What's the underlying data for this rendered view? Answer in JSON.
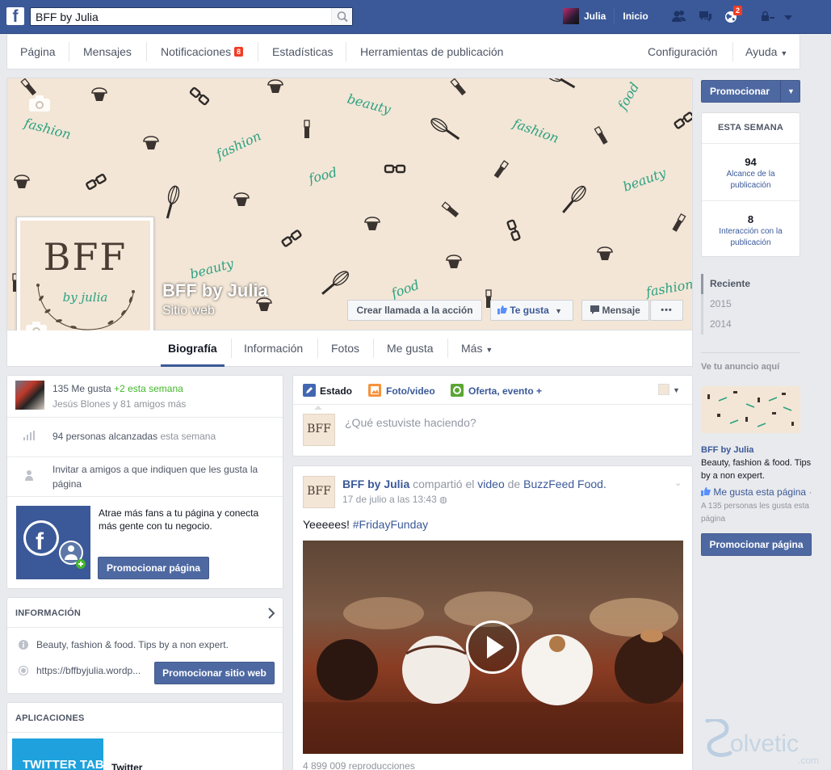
{
  "topbar": {
    "search_value": "BFF by Julia",
    "user_name": "Julia",
    "home_label": "Inicio",
    "notifications_badge": "2",
    "brand_color": "#3b5998"
  },
  "page_nav": {
    "items": [
      "Página",
      "Mensajes",
      "Notificaciones",
      "Estadísticas",
      "Herramientas de publicación"
    ],
    "notifications_badge": "8",
    "settings_label": "Configuración",
    "help_label": "Ayuda"
  },
  "cover": {
    "words": [
      "beauty",
      "fashion",
      "food"
    ]
  },
  "profile": {
    "logo_text": "BFF",
    "logo_sub": "by julia",
    "page_name": "BFF by Julia",
    "category": "Sitio web",
    "cta_button": "Crear llamada a la acción",
    "like_button": "Te gusta",
    "message_button": "Mensaje",
    "more_button": "•••"
  },
  "tabs": {
    "items": [
      "Biografía",
      "Información",
      "Fotos",
      "Me gusta",
      "Más"
    ],
    "active": "Biografía"
  },
  "left": {
    "likes_count": "135 Me gusta",
    "likes_delta": "+2 esta semana",
    "likes_friends": "Jesús Blones y 81 amigos más",
    "reach_text": "94 personas alcanzadas",
    "reach_suffix": "esta semana",
    "invite_text": "Invitar a amigos a que indiquen que les gusta la página",
    "promo_text": "Atrae más fans a tu página y conecta más gente con tu negocio.",
    "promo_button": "Promocionar página",
    "info_title": "INFORMACIÓN",
    "info_description": "Beauty, fashion & food. Tips by a non expert.",
    "info_website": "https://bffbyjulia.wordp...",
    "promo_site_button": "Promocionar sitio web",
    "apps_title": "APLICACIONES",
    "app_tile": "TWITTER TAB",
    "app_name": "Twitter"
  },
  "composer": {
    "tab_status": "Estado",
    "tab_photo": "Foto/video",
    "tab_offer": "Oferta, evento +",
    "placeholder": "¿Qué estuviste haciendo?"
  },
  "post": {
    "author": "BFF by Julia",
    "shared_word": "compartió el",
    "video_word": "video",
    "de_word": "de",
    "source": "BuzzFeed Food.",
    "date": "17 de julio a las 13:43",
    "text_prefix": "Yeeeees!",
    "hashtag": "#FridayFunday",
    "views": "4 899 009 reproducciones"
  },
  "right": {
    "promote_button": "Promocionar",
    "week_title": "ESTA SEMANA",
    "reach_value": "94",
    "reach_label": "Alcance de la publicación",
    "engagement_value": "8",
    "engagement_label": "Interacción con la publicación",
    "timeline": [
      "Reciente",
      "2015",
      "2014"
    ],
    "ad_title": "Ve tu anuncio aquí",
    "ad_page": "BFF by Julia",
    "ad_desc": "Beauty, fashion & food. Tips by a non expert.",
    "ad_like": "Me gusta esta página",
    "ad_like_sep": "·",
    "ad_count": "A 135 personas les gusta esta página",
    "ad_button": "Promocionar página"
  },
  "watermark": {
    "text": "olvetic",
    "suffix": ".com"
  }
}
